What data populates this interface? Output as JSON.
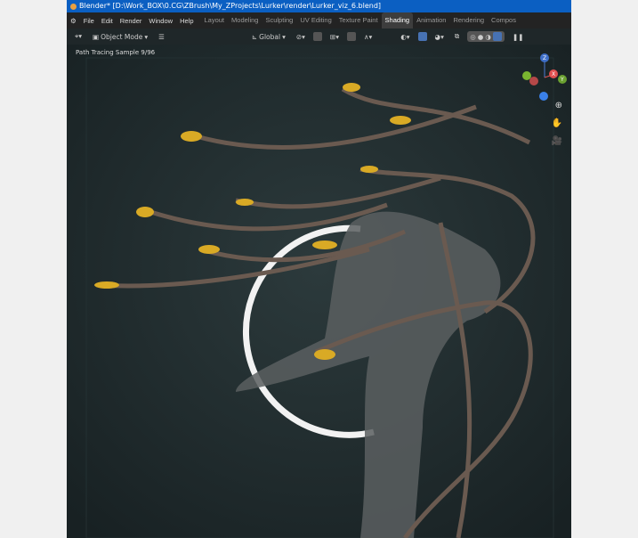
{
  "title": "Blender* [D:\\Work_BOX\\0.CG\\ZBrush\\My_ZProjects\\Lurker\\render\\Lurker_viz_6.blend]",
  "menu": [
    "File",
    "Edit",
    "Render",
    "Window",
    "Help"
  ],
  "workspaces": [
    "Layout",
    "Modeling",
    "Sculpting",
    "UV Editing",
    "Texture Paint",
    "Shading",
    "Animation",
    "Rendering",
    "Compos"
  ],
  "active_workspace": "Shading",
  "toolbar": {
    "mode": "Object Mode",
    "transform_orientation": "Global"
  },
  "viewport": {
    "status": "Path Tracing Sample 9/96",
    "gizmo_axes": [
      "X",
      "Y",
      "Z"
    ]
  },
  "colors": {
    "accent": "#4772b3",
    "titlebar": "#0b5fc2"
  }
}
